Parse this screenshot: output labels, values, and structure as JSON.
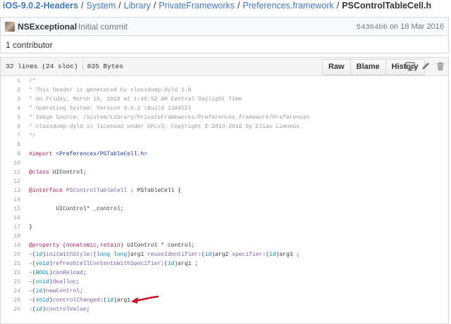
{
  "breadcrumb": {
    "repo": "iOS-9.0.2-Headers",
    "p1": "System",
    "p2": "Library",
    "p3": "PrivateFrameworks",
    "p4": "Preferences.framework",
    "file": "PSControlTableCell.h",
    "separator": "/"
  },
  "commit": {
    "author": "NSExceptional",
    "message": "Initial commit",
    "sha": "54364bb",
    "date_prefix": "on 18 Mar 2016"
  },
  "contributors": "1 contributor",
  "file_info": {
    "lines": "32 lines (24 sloc)",
    "size": "835 Bytes"
  },
  "buttons": {
    "raw": "Raw",
    "blame": "Blame",
    "history": "History"
  },
  "icons": {
    "desktop": "desktop-icon",
    "edit": "pencil-icon",
    "delete": "trash-icon",
    "annotation": "red-arrow-icon"
  },
  "colors": {
    "link": "#4078c0",
    "keyword": "#a71d5d",
    "type": "#0086b3",
    "function": "#795da3",
    "string": "#183691",
    "comment": "#969896",
    "arrow": "#d0021b"
  },
  "code_lines": [
    {
      "n": "1",
      "t": "/*"
    },
    {
      "n": "2",
      "t": "* This header is generated by classdump-dyld 1.0"
    },
    {
      "n": "3",
      "t": "* on Friday, March 18, 2016 at 1:48:52 AM Central Daylight Time"
    },
    {
      "n": "4",
      "t": "* Operating System: Version 9.0.2 (Build 13A452)"
    },
    {
      "n": "5",
      "t": "* Image Source: /System/Library/PrivateFrameworks/Preferences.framework/Preferences"
    },
    {
      "n": "6",
      "t": "* classdump-dyld is licensed under GPLv3, Copyright © 2013-2016 by Elias Limneos."
    },
    {
      "n": "7",
      "t": "*/"
    },
    {
      "n": "8",
      "t": ""
    },
    {
      "n": "9",
      "t": "#import <Preferences/PSTableCell.h>"
    },
    {
      "n": "10",
      "t": ""
    },
    {
      "n": "11",
      "t": "@class UIControl;"
    },
    {
      "n": "12",
      "t": ""
    },
    {
      "n": "13",
      "t": "@interface PSControlTableCell : PSTableCell {"
    },
    {
      "n": "14",
      "t": ""
    },
    {
      "n": "15",
      "t": "        UIControl* _control;"
    },
    {
      "n": "16",
      "t": ""
    },
    {
      "n": "17",
      "t": "}"
    },
    {
      "n": "18",
      "t": ""
    },
    {
      "n": "19",
      "t": "@property (nonatomic,retain) UIControl * control;"
    },
    {
      "n": "20",
      "t": "-(id)initWithStyle:(long long)arg1 reuseIdentifier:(id)arg2 specifier:(id)arg3 ;"
    },
    {
      "n": "21",
      "t": "-(void)refreshCellContentsWithSpecifier:(id)arg1 ;"
    },
    {
      "n": "22",
      "t": "-(BOOL)canReload;"
    },
    {
      "n": "23",
      "t": "-(void)dealloc;"
    },
    {
      "n": "24",
      "t": "-(id)newControl;"
    },
    {
      "n": "25",
      "t": "-(void)controlChanged:(id)arg1 ;"
    },
    {
      "n": "26",
      "t": "-(id)controlValue;"
    }
  ]
}
